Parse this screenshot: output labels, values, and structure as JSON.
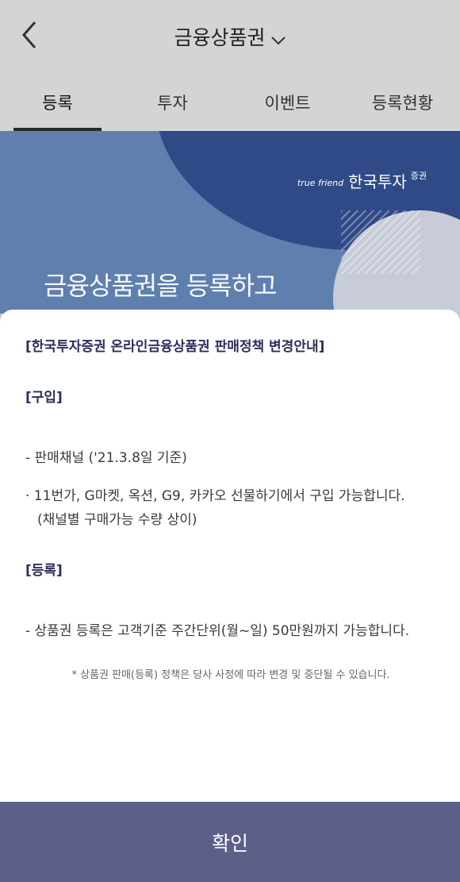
{
  "header": {
    "title": "금융상품권",
    "tabs": [
      {
        "label": "등록"
      },
      {
        "label": "투자"
      },
      {
        "label": "이벤트"
      },
      {
        "label": "등록현황"
      }
    ]
  },
  "banner": {
    "brand_small": "true friend",
    "brand_name": "한국투자",
    "brand_sub": "증권",
    "headline": "금융상품권을 등록하고"
  },
  "notice": {
    "title": "[한국투자증권 온라인금융상품권 판매정책 변경안내]",
    "purchase_heading": "[구입]",
    "channel_line": "- 판매채널 ('21.3.8일 기준)",
    "channel_list": "· 11번가, G마켓, 옥션, G9, 카카오 선물하기에서 구입 가능합니다.",
    "channel_note": "(채널별 구매가능 수량 상이)",
    "register_heading": "[등록]",
    "register_line": "- 상품권 등록은 고객기준 주간단위(월~일) 50만원까지 가능합니다.",
    "footnote": "* 상품권 판매(등록) 정책은 당사 사정에 따라 변경 및 중단될 수 있습니다."
  },
  "confirm_label": "확인",
  "colors": {
    "confirm_bg": "#5c5f88",
    "heading": "#2a2f5c",
    "banner_dark": "#2f4a86"
  }
}
